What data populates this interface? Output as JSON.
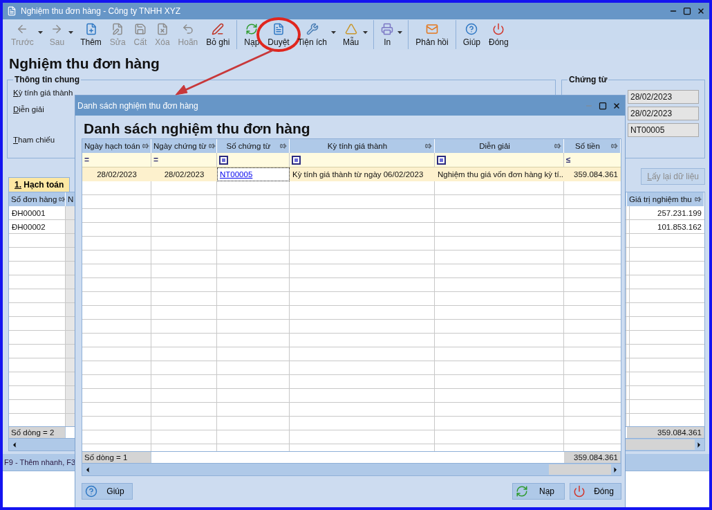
{
  "window": {
    "title": "Nghiệm thu đơn hàng - Công ty TNHH XYZ"
  },
  "toolbar": [
    [
      {
        "label": "Trước",
        "disabled": true,
        "dropdown": true,
        "circled": false
      },
      {
        "label": "Sau",
        "disabled": true,
        "dropdown": true,
        "circled": false
      },
      {
        "label": "Thêm",
        "disabled": false,
        "dropdown": false,
        "circled": false
      },
      {
        "label": "Sửa",
        "disabled": true,
        "dropdown": false,
        "circled": false
      },
      {
        "label": "Cất",
        "disabled": true,
        "dropdown": false,
        "circled": false
      },
      {
        "label": "Xóa",
        "disabled": true,
        "dropdown": false,
        "circled": false
      },
      {
        "label": "Hoãn",
        "disabled": true,
        "dropdown": false,
        "circled": false
      },
      {
        "label": "Bỏ ghi",
        "disabled": false,
        "dropdown": false,
        "circled": false
      }
    ],
    [
      {
        "label": "Nạp",
        "disabled": false,
        "dropdown": false,
        "circled": false
      },
      {
        "label": "Duyệt",
        "disabled": false,
        "dropdown": false,
        "circled": true
      },
      {
        "label": "Tiện ích",
        "disabled": false,
        "dropdown": true,
        "circled": false
      },
      {
        "label": "Mẫu",
        "disabled": false,
        "dropdown": true,
        "circled": false
      }
    ],
    [
      {
        "label": "In",
        "disabled": false,
        "dropdown": true,
        "circled": false
      }
    ],
    [
      {
        "label": "Phản hồi",
        "disabled": false,
        "dropdown": false,
        "circled": false
      }
    ],
    [
      {
        "label": "Giúp",
        "disabled": false,
        "dropdown": false,
        "circled": false
      },
      {
        "label": "Đóng",
        "disabled": false,
        "dropdown": false,
        "circled": false
      }
    ]
  ],
  "page_title": "Nghiệm thu đơn hàng",
  "general_group": {
    "title": "Thông tin chung",
    "labels": [
      "Kỳ tính giá thành",
      "Diễn giải",
      "Tham chiếu"
    ]
  },
  "document_group": {
    "title": "Chứng từ",
    "fields": [
      "28/02/2023",
      "28/02/2023",
      "NT00005"
    ]
  },
  "reload_button": {
    "label": "Lấy lại dữ liệu",
    "disabled": true
  },
  "tabs": [
    {
      "label": "1. Hạch toán",
      "selected": true
    }
  ],
  "detail_table": {
    "columns": [
      "Số đơn hàng",
      "N",
      "Giá trị nghiệm thu"
    ],
    "rows": [
      {
        "order": "ĐH00001",
        "value": "257.231.199"
      },
      {
        "order": "ĐH00002",
        "value": "101.853.162"
      }
    ],
    "footer": {
      "count": "Số dòng = 2",
      "total": "359.084.361"
    }
  },
  "status_bar": "F9 - Thêm nhanh, F3",
  "dialog": {
    "title": "Danh sách nghiệm thu đơn hàng",
    "heading": "Danh sách nghiệm thu đơn hàng",
    "table": {
      "columns": [
        "Ngày hạch toán",
        "Ngày chứng từ",
        "Số chứng từ",
        "Kỳ tính giá thành",
        "Diễn giải",
        "Số tiền"
      ],
      "filters": [
        {
          "kind": "text",
          "symbol": "="
        },
        {
          "kind": "text",
          "symbol": "="
        },
        {
          "kind": "square"
        },
        {
          "kind": "square"
        },
        {
          "kind": "square"
        },
        {
          "kind": "text",
          "symbol": "≤"
        }
      ],
      "rows": [
        {
          "selected": true,
          "cells": [
            "28/02/2023",
            "28/02/2023",
            "NT00005",
            "Kỳ tính giá thành từ ngày 06/02/2023",
            "Nghiệm thu giá vốn đơn hàng kỳ tí..",
            "359.084.361"
          ]
        }
      ],
      "footer": {
        "count": "Số dòng = 1",
        "total": "359.084.361"
      }
    },
    "buttons": [
      {
        "label": "Giúp"
      },
      {
        "label": "Nạp"
      },
      {
        "label": "Đóng"
      }
    ]
  }
}
